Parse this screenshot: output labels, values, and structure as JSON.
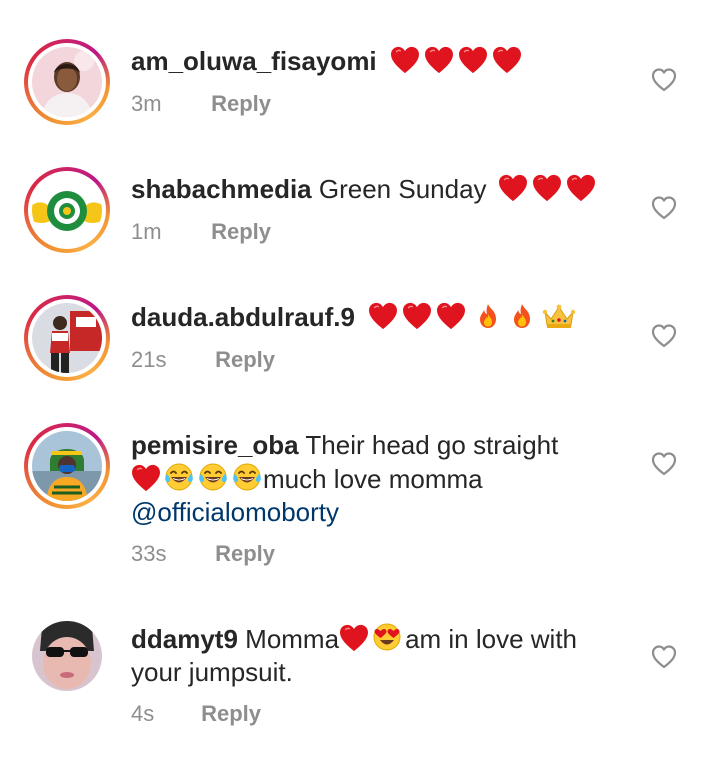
{
  "comments": [
    {
      "username": "am_oluwa_fisayomi",
      "text": "",
      "emoji": [
        "heart",
        "heart",
        "heart",
        "heart"
      ],
      "time": "3m",
      "reply_label": "Reply"
    },
    {
      "username": "shabachmedia",
      "text": "Green Sunday",
      "emoji": [
        "heart",
        "heart",
        "heart"
      ],
      "time": "1m",
      "reply_label": "Reply"
    },
    {
      "username": "dauda.abdulrauf.9",
      "text": "",
      "emoji": [
        "heart",
        "heart",
        "heart",
        "fire",
        "fire",
        "crown"
      ],
      "time": "21s",
      "reply_label": "Reply"
    },
    {
      "username": "pemisire_oba",
      "text_line1": "Their head go straight",
      "text_line2_suffix": "much love momma",
      "mention": "@officialomoborty",
      "emoji": [
        "heart",
        "tears-of-joy",
        "tears-of-joy",
        "tears-of-joy"
      ],
      "time": "33s",
      "reply_label": "Reply"
    },
    {
      "username": "ddamyt9",
      "text_part1": "Momma",
      "text_part2": "am in love with",
      "text_line2": "your jumpsuit.",
      "emoji": [
        "heart",
        "heart-eyes"
      ],
      "time": "4s",
      "reply_label": "Reply"
    }
  ],
  "colors": {
    "username": "#262626",
    "meta": "#8e8e8e",
    "mention": "#00376b",
    "heart": "#e0141e",
    "story_ring_start": "#f09433",
    "story_ring_end": "#bc1888"
  },
  "icons": {
    "like": "heart-outline-icon"
  }
}
